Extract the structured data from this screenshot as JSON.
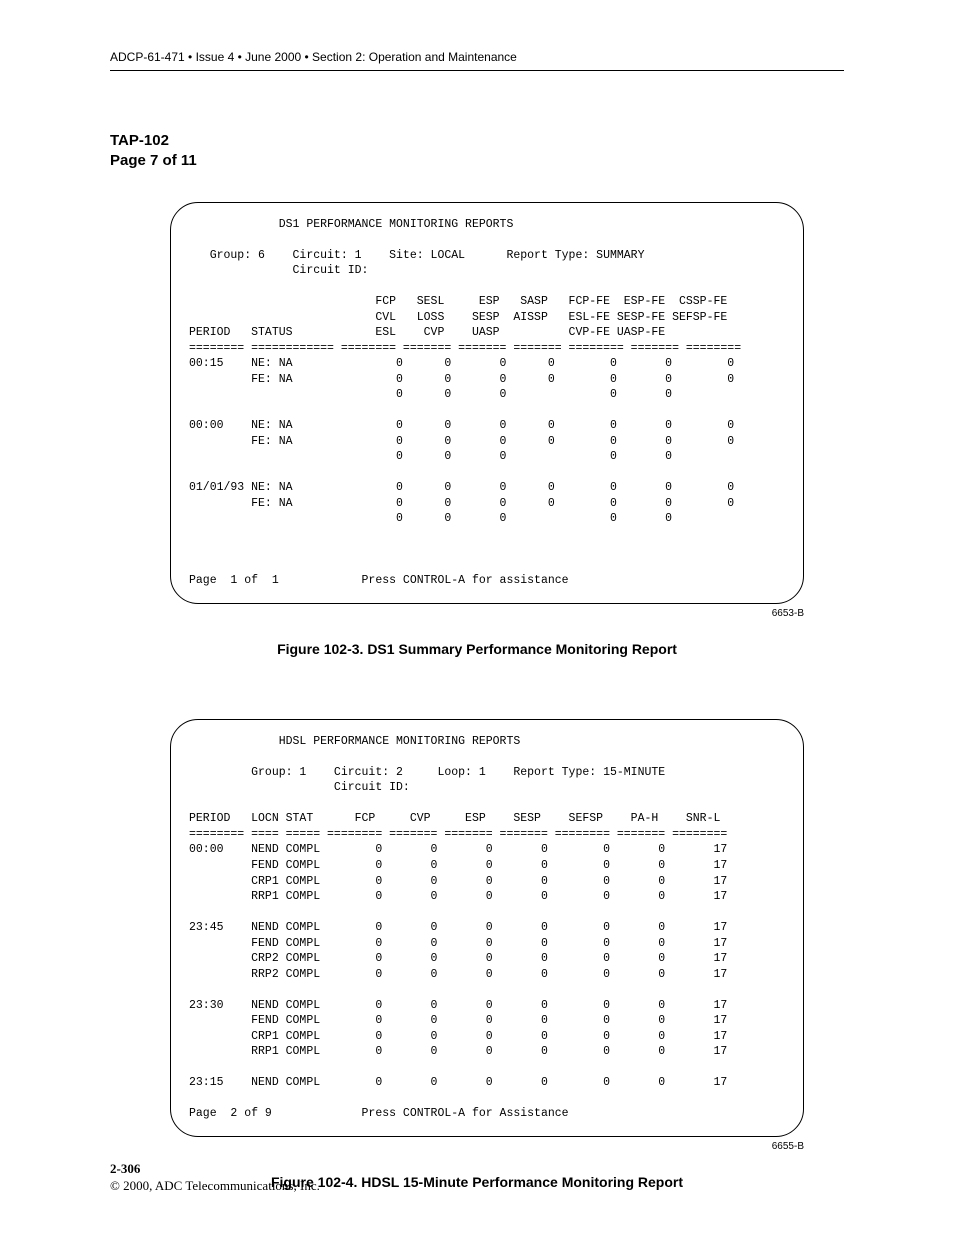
{
  "header": "ADCP-61-471 • Issue 4 • June 2000 • Section 2: Operation and Maintenance",
  "tap": {
    "title": "TAP-102",
    "page": "Page 7 of 11"
  },
  "fig1": {
    "title": "DS1 PERFORMANCE MONITORING REPORTS",
    "meta1": "   Group: 6    Circuit: 1    Site: LOCAL      Report Type: SUMMARY",
    "meta2": "               Circuit ID:",
    "hdr1": "                           FCP   SESL     ESP   SASP   FCP-FE  ESP-FE  CSSP-FE",
    "hdr2": "                           CVL   LOSS    SESP  AISSP   ESL-FE SESP-FE SEFSP-FE",
    "hdr3": "PERIOD   STATUS            ESL    CVP    UASP          CVP-FE UASP-FE",
    "sep": "======== ============ ======== ======= ======= ======= ======== ======= ========",
    "rows": [
      "00:15    NE: NA               0      0       0      0        0       0        0",
      "         FE: NA               0      0       0      0        0       0        0",
      "                              0      0       0               0       0",
      "",
      "00:00    NE: NA               0      0       0      0        0       0        0",
      "         FE: NA               0      0       0      0        0       0        0",
      "                              0      0       0               0       0",
      "",
      "01/01/93 NE: NA               0      0       0      0        0       0        0",
      "         FE: NA               0      0       0      0        0       0        0",
      "                              0      0       0               0       0"
    ],
    "footer": "Page  1 of  1            Press CONTROL-A for assistance",
    "code": "6653-B",
    "caption": "Figure 102-3. DS1 Summary Performance Monitoring Report"
  },
  "fig2": {
    "title": "HDSL PERFORMANCE MONITORING REPORTS",
    "meta1": "         Group: 1    Circuit: 2     Loop: 1    Report Type: 15-MINUTE",
    "meta2": "                     Circuit ID:",
    "hdr": "PERIOD   LOCN STAT      FCP     CVP     ESP    SESP    SEFSP    PA-H    SNR-L",
    "sep": "======== ==== ===== ======== ======= ======= ======= ======== ======= ========",
    "rows": [
      "00:00    NEND COMPL        0       0       0       0        0       0       17",
      "         FEND COMPL        0       0       0       0        0       0       17",
      "         CRP1 COMPL        0       0       0       0        0       0       17",
      "         RRP1 COMPL        0       0       0       0        0       0       17",
      "",
      "23:45    NEND COMPL        0       0       0       0        0       0       17",
      "         FEND COMPL        0       0       0       0        0       0       17",
      "         CRP2 COMPL        0       0       0       0        0       0       17",
      "         RRP2 COMPL        0       0       0       0        0       0       17",
      "",
      "23:30    NEND COMPL        0       0       0       0        0       0       17",
      "         FEND COMPL        0       0       0       0        0       0       17",
      "         CRP1 COMPL        0       0       0       0        0       0       17",
      "         RRP1 COMPL        0       0       0       0        0       0       17",
      "",
      "23:15    NEND COMPL        0       0       0       0        0       0       17"
    ],
    "footer": "Page  2 of 9             Press CONTROL-A for Assistance",
    "code": "6655-B",
    "caption": "Figure 102-4. HDSL 15-Minute Performance Monitoring Report"
  },
  "footer": {
    "pageno": "2-306",
    "copyright": "© 2000, ADC Telecommunications, Inc."
  },
  "chart_data": [
    {
      "type": "table",
      "title": "DS1 Performance Monitoring Reports — Summary (Group 6, Circuit 1, Site LOCAL)",
      "columns_line1": [
        "PERIOD",
        "STATUS",
        "FCP",
        "SESL",
        "ESP",
        "SASP",
        "FCP-FE",
        "ESP-FE",
        "CSSP-FE"
      ],
      "columns_line2": [
        "",
        "",
        "CVL",
        "LOSS",
        "SESP",
        "AISSP",
        "ESL-FE",
        "SESP-FE",
        "SEFSP-FE"
      ],
      "columns_line3": [
        "",
        "",
        "ESL",
        "CVP",
        "UASP",
        "",
        "CVP-FE",
        "UASP-FE",
        ""
      ],
      "periods": [
        {
          "period": "00:15",
          "ne_line1": [
            0,
            0,
            0,
            0,
            0,
            0,
            0
          ],
          "fe_line2": [
            0,
            0,
            0,
            0,
            0,
            0,
            0
          ],
          "line3": [
            0,
            0,
            0,
            null,
            0,
            0,
            null
          ]
        },
        {
          "period": "00:00",
          "ne_line1": [
            0,
            0,
            0,
            0,
            0,
            0,
            0
          ],
          "fe_line2": [
            0,
            0,
            0,
            0,
            0,
            0,
            0
          ],
          "line3": [
            0,
            0,
            0,
            null,
            0,
            0,
            null
          ]
        },
        {
          "period": "01/01/93",
          "ne_line1": [
            0,
            0,
            0,
            0,
            0,
            0,
            0
          ],
          "fe_line2": [
            0,
            0,
            0,
            0,
            0,
            0,
            0
          ],
          "line3": [
            0,
            0,
            0,
            null,
            0,
            0,
            null
          ]
        }
      ],
      "page_info": "Page 1 of 1"
    },
    {
      "type": "table",
      "title": "HDSL Performance Monitoring Reports — 15-Minute (Group 1, Circuit 2, Loop 1)",
      "columns": [
        "PERIOD",
        "LOCN",
        "STAT",
        "FCP",
        "CVP",
        "ESP",
        "SESP",
        "SEFSP",
        "PA-H",
        "SNR-L"
      ],
      "rows": [
        [
          "00:00",
          "NEND",
          "COMPL",
          0,
          0,
          0,
          0,
          0,
          0,
          17
        ],
        [
          "00:00",
          "FEND",
          "COMPL",
          0,
          0,
          0,
          0,
          0,
          0,
          17
        ],
        [
          "00:00",
          "CRP1",
          "COMPL",
          0,
          0,
          0,
          0,
          0,
          0,
          17
        ],
        [
          "00:00",
          "RRP1",
          "COMPL",
          0,
          0,
          0,
          0,
          0,
          0,
          17
        ],
        [
          "23:45",
          "NEND",
          "COMPL",
          0,
          0,
          0,
          0,
          0,
          0,
          17
        ],
        [
          "23:45",
          "FEND",
          "COMPL",
          0,
          0,
          0,
          0,
          0,
          0,
          17
        ],
        [
          "23:45",
          "CRP2",
          "COMPL",
          0,
          0,
          0,
          0,
          0,
          0,
          17
        ],
        [
          "23:45",
          "RRP2",
          "COMPL",
          0,
          0,
          0,
          0,
          0,
          0,
          17
        ],
        [
          "23:30",
          "NEND",
          "COMPL",
          0,
          0,
          0,
          0,
          0,
          0,
          17
        ],
        [
          "23:30",
          "FEND",
          "COMPL",
          0,
          0,
          0,
          0,
          0,
          0,
          17
        ],
        [
          "23:30",
          "CRP1",
          "COMPL",
          0,
          0,
          0,
          0,
          0,
          0,
          17
        ],
        [
          "23:30",
          "RRP1",
          "COMPL",
          0,
          0,
          0,
          0,
          0,
          0,
          17
        ],
        [
          "23:15",
          "NEND",
          "COMPL",
          0,
          0,
          0,
          0,
          0,
          0,
          17
        ]
      ],
      "page_info": "Page 2 of 9"
    }
  ]
}
